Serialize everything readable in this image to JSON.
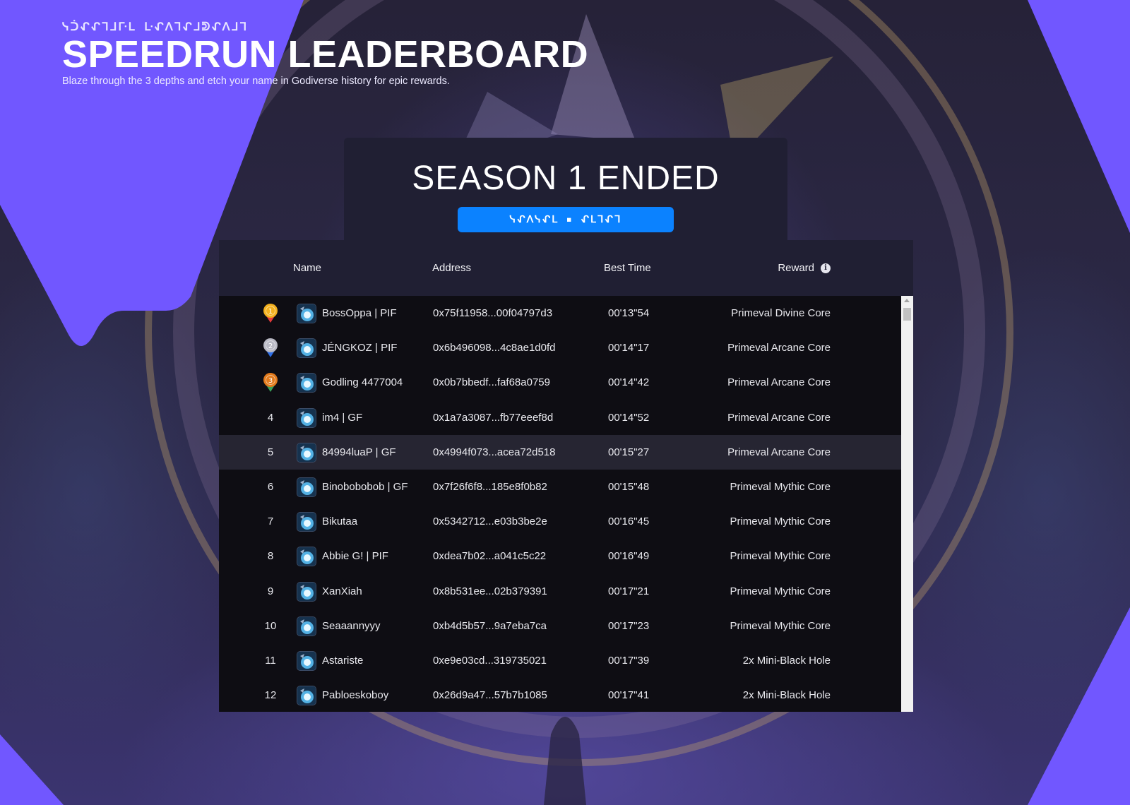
{
  "header": {
    "glyph_title": "ᓭᑑᖋᖋᒣᒧᒯᒪ ᒷᖋᐱᒣᖋᒧᕲᖋᐱᒧᒣ",
    "title": "SPEEDRUN LEADERBOARD",
    "subtitle": "Blaze through the 3 depths and etch your name in Godiverse history for epic rewards."
  },
  "season": {
    "title": "SEASON 1 ENDED",
    "button_label": "ᓭᖋᐱᓭᖋᒪ ▪ ᖋᒪᒣᖋᒣ"
  },
  "table": {
    "columns": {
      "name": "Name",
      "address": "Address",
      "best_time": "Best Time",
      "reward": "Reward"
    },
    "reward_info_icon": "info-icon",
    "rows": [
      {
        "rank": "1",
        "medal": "gold",
        "name": "BossOppa | PIF",
        "address": "0x75f11958...00f04797d3",
        "time": "00'13\"54",
        "reward": "Primeval Divine Core"
      },
      {
        "rank": "2",
        "medal": "silver",
        "name": "JÉNGKOZ | PIF",
        "address": "0x6b496098...4c8ae1d0fd",
        "time": "00'14\"17",
        "reward": "Primeval Arcane Core"
      },
      {
        "rank": "3",
        "medal": "bronze",
        "name": "Godling 4477004",
        "address": "0x0b7bbedf...faf68a0759",
        "time": "00'14\"42",
        "reward": "Primeval Arcane Core"
      },
      {
        "rank": "4",
        "medal": "",
        "name": "im4 | GF",
        "address": "0x1a7a3087...fb77eeef8d",
        "time": "00'14\"52",
        "reward": "Primeval Arcane Core"
      },
      {
        "rank": "5",
        "medal": "",
        "name": "84994luaP | GF",
        "address": "0x4994f073...acea72d518",
        "time": "00'15\"27",
        "reward": "Primeval Arcane Core"
      },
      {
        "rank": "6",
        "medal": "",
        "name": "Binobobobob | GF",
        "address": "0x7f26f6f8...185e8f0b82",
        "time": "00'15\"48",
        "reward": "Primeval Mythic Core"
      },
      {
        "rank": "7",
        "medal": "",
        "name": "Bikutaa",
        "address": "0x5342712...e03b3be2e",
        "time": "00'16\"45",
        "reward": "Primeval Mythic Core"
      },
      {
        "rank": "8",
        "medal": "",
        "name": "Abbie G! | PIF",
        "address": "0xdea7b02...a041c5c22",
        "time": "00'16\"49",
        "reward": "Primeval Mythic Core"
      },
      {
        "rank": "9",
        "medal": "",
        "name": "XanXiah",
        "address": "0x8b531ee...02b379391",
        "time": "00'17\"21",
        "reward": "Primeval Mythic Core"
      },
      {
        "rank": "10",
        "medal": "",
        "name": "Seaaannyyy",
        "address": "0xb4d5b57...9a7eba7ca",
        "time": "00'17\"23",
        "reward": "Primeval Mythic Core"
      },
      {
        "rank": "11",
        "medal": "",
        "name": "Astariste",
        "address": "0xe9e03cd...319735021",
        "time": "00'17\"39",
        "reward": "2x Mini-Black Hole"
      },
      {
        "rank": "12",
        "medal": "",
        "name": "Pabloeskoboy",
        "address": "0x26d9a47...57b7b1085",
        "time": "00'17\"41",
        "reward": "2x Mini-Black Hole"
      }
    ]
  },
  "colors": {
    "accent_purple": "#7157ff",
    "button_blue": "#0b82ff",
    "panel": "#201f33",
    "table_bg": "#0e0d13",
    "highlight_row": "#262532",
    "medal_gold": "#f2b01e",
    "medal_silver": "#b9b9c4",
    "medal_bronze": "#e27a1c"
  }
}
